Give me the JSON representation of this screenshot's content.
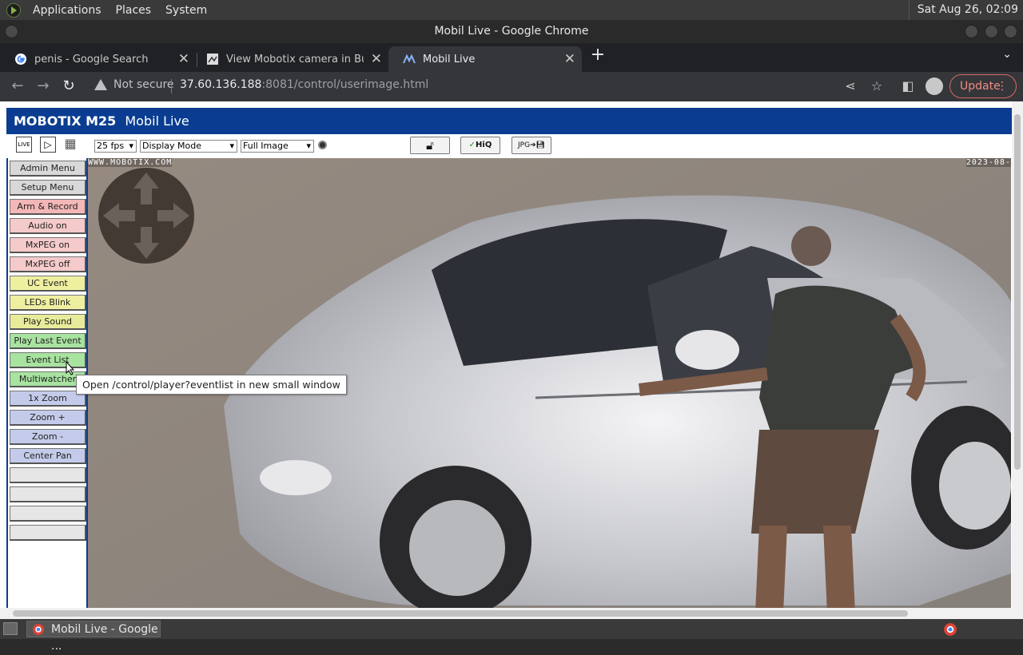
{
  "top_panel": {
    "menus": [
      "Applications",
      "Places",
      "System"
    ],
    "clock": "Sat Aug 26, 02:09"
  },
  "window": {
    "title": "Mobil Live - Google Chrome"
  },
  "tabs": [
    {
      "title": "penis - Google Search",
      "icon": "google-icon"
    },
    {
      "title": "View Mobotix camera in Bulga",
      "icon": "camera-site-icon"
    },
    {
      "title": "Mobil Live",
      "icon": "mobotix-icon"
    }
  ],
  "toolbar": {
    "security_label": "Not secure",
    "url_host": "37.60.136.188",
    "url_rest": ":8081/control/userimage.html",
    "update_label": "Update"
  },
  "page": {
    "brand": "MOBOTIX M25",
    "title": "Mobil Live",
    "controls": {
      "fps": "25 fps",
      "display_mode": "Display Mode",
      "image_mode": "Full Image",
      "hiq_label": "HiQ",
      "live_label": "LIVE"
    },
    "sidebar_buttons": [
      {
        "label": "Admin Menu",
        "color": "#d8d8d8"
      },
      {
        "label": "Setup Menu",
        "color": "#d8d8d8"
      },
      {
        "label": "Arm & Record",
        "color": "#f3b7b7"
      },
      {
        "label": "Audio on",
        "color": "#f5caca"
      },
      {
        "label": "MxPEG on",
        "color": "#f5caca"
      },
      {
        "label": "MxPEG off",
        "color": "#f5caca"
      },
      {
        "label": "UC Event",
        "color": "#eef0a0"
      },
      {
        "label": "LEDs Blink",
        "color": "#eef0a0"
      },
      {
        "label": "Play Sound",
        "color": "#e8ec9a"
      },
      {
        "label": "Play Last Event",
        "color": "#a8e3a0"
      },
      {
        "label": "Event List",
        "color": "#a8e3a0"
      },
      {
        "label": "Multiwatcher",
        "color": "#a8e3a0"
      },
      {
        "label": "1x Zoom",
        "color": "#c4cbea"
      },
      {
        "label": "Zoom +",
        "color": "#c4cbea"
      },
      {
        "label": "Zoom -",
        "color": "#c4cbea"
      },
      {
        "label": "Center Pan",
        "color": "#c4cbea"
      },
      {
        "label": "",
        "color": "#e6e6e6"
      },
      {
        "label": "",
        "color": "#e6e6e6"
      },
      {
        "label": "",
        "color": "#e6e6e6"
      },
      {
        "label": "",
        "color": "#e6e6e6"
      }
    ],
    "camera": {
      "watermark": "WWW.MOBOTIX.COM",
      "timestamp": "2023-08-"
    },
    "tooltip": "Open /control/player?eventlist in new small window"
  },
  "taskbar": {
    "item_label": "Mobil Live - Google ..."
  }
}
